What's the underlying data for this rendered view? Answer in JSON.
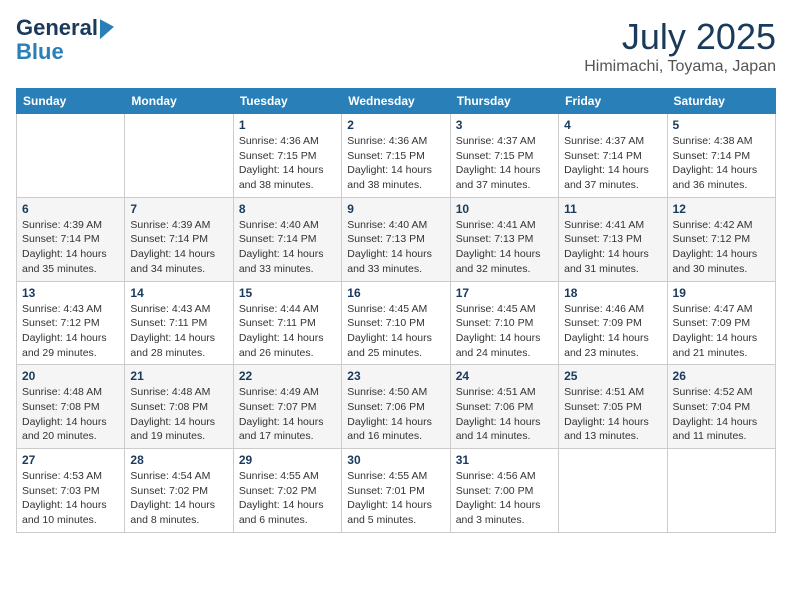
{
  "header": {
    "logo_line1": "General",
    "logo_line2": "Blue",
    "month": "July 2025",
    "location": "Himimachi, Toyama, Japan"
  },
  "days_of_week": [
    "Sunday",
    "Monday",
    "Tuesday",
    "Wednesday",
    "Thursday",
    "Friday",
    "Saturday"
  ],
  "weeks": [
    [
      {
        "day": "",
        "info": ""
      },
      {
        "day": "",
        "info": ""
      },
      {
        "day": "1",
        "info": "Sunrise: 4:36 AM\nSunset: 7:15 PM\nDaylight: 14 hours\nand 38 minutes."
      },
      {
        "day": "2",
        "info": "Sunrise: 4:36 AM\nSunset: 7:15 PM\nDaylight: 14 hours\nand 38 minutes."
      },
      {
        "day": "3",
        "info": "Sunrise: 4:37 AM\nSunset: 7:15 PM\nDaylight: 14 hours\nand 37 minutes."
      },
      {
        "day": "4",
        "info": "Sunrise: 4:37 AM\nSunset: 7:14 PM\nDaylight: 14 hours\nand 37 minutes."
      },
      {
        "day": "5",
        "info": "Sunrise: 4:38 AM\nSunset: 7:14 PM\nDaylight: 14 hours\nand 36 minutes."
      }
    ],
    [
      {
        "day": "6",
        "info": "Sunrise: 4:39 AM\nSunset: 7:14 PM\nDaylight: 14 hours\nand 35 minutes."
      },
      {
        "day": "7",
        "info": "Sunrise: 4:39 AM\nSunset: 7:14 PM\nDaylight: 14 hours\nand 34 minutes."
      },
      {
        "day": "8",
        "info": "Sunrise: 4:40 AM\nSunset: 7:14 PM\nDaylight: 14 hours\nand 33 minutes."
      },
      {
        "day": "9",
        "info": "Sunrise: 4:40 AM\nSunset: 7:13 PM\nDaylight: 14 hours\nand 33 minutes."
      },
      {
        "day": "10",
        "info": "Sunrise: 4:41 AM\nSunset: 7:13 PM\nDaylight: 14 hours\nand 32 minutes."
      },
      {
        "day": "11",
        "info": "Sunrise: 4:41 AM\nSunset: 7:13 PM\nDaylight: 14 hours\nand 31 minutes."
      },
      {
        "day": "12",
        "info": "Sunrise: 4:42 AM\nSunset: 7:12 PM\nDaylight: 14 hours\nand 30 minutes."
      }
    ],
    [
      {
        "day": "13",
        "info": "Sunrise: 4:43 AM\nSunset: 7:12 PM\nDaylight: 14 hours\nand 29 minutes."
      },
      {
        "day": "14",
        "info": "Sunrise: 4:43 AM\nSunset: 7:11 PM\nDaylight: 14 hours\nand 28 minutes."
      },
      {
        "day": "15",
        "info": "Sunrise: 4:44 AM\nSunset: 7:11 PM\nDaylight: 14 hours\nand 26 minutes."
      },
      {
        "day": "16",
        "info": "Sunrise: 4:45 AM\nSunset: 7:10 PM\nDaylight: 14 hours\nand 25 minutes."
      },
      {
        "day": "17",
        "info": "Sunrise: 4:45 AM\nSunset: 7:10 PM\nDaylight: 14 hours\nand 24 minutes."
      },
      {
        "day": "18",
        "info": "Sunrise: 4:46 AM\nSunset: 7:09 PM\nDaylight: 14 hours\nand 23 minutes."
      },
      {
        "day": "19",
        "info": "Sunrise: 4:47 AM\nSunset: 7:09 PM\nDaylight: 14 hours\nand 21 minutes."
      }
    ],
    [
      {
        "day": "20",
        "info": "Sunrise: 4:48 AM\nSunset: 7:08 PM\nDaylight: 14 hours\nand 20 minutes."
      },
      {
        "day": "21",
        "info": "Sunrise: 4:48 AM\nSunset: 7:08 PM\nDaylight: 14 hours\nand 19 minutes."
      },
      {
        "day": "22",
        "info": "Sunrise: 4:49 AM\nSunset: 7:07 PM\nDaylight: 14 hours\nand 17 minutes."
      },
      {
        "day": "23",
        "info": "Sunrise: 4:50 AM\nSunset: 7:06 PM\nDaylight: 14 hours\nand 16 minutes."
      },
      {
        "day": "24",
        "info": "Sunrise: 4:51 AM\nSunset: 7:06 PM\nDaylight: 14 hours\nand 14 minutes."
      },
      {
        "day": "25",
        "info": "Sunrise: 4:51 AM\nSunset: 7:05 PM\nDaylight: 14 hours\nand 13 minutes."
      },
      {
        "day": "26",
        "info": "Sunrise: 4:52 AM\nSunset: 7:04 PM\nDaylight: 14 hours\nand 11 minutes."
      }
    ],
    [
      {
        "day": "27",
        "info": "Sunrise: 4:53 AM\nSunset: 7:03 PM\nDaylight: 14 hours\nand 10 minutes."
      },
      {
        "day": "28",
        "info": "Sunrise: 4:54 AM\nSunset: 7:02 PM\nDaylight: 14 hours\nand 8 minutes."
      },
      {
        "day": "29",
        "info": "Sunrise: 4:55 AM\nSunset: 7:02 PM\nDaylight: 14 hours\nand 6 minutes."
      },
      {
        "day": "30",
        "info": "Sunrise: 4:55 AM\nSunset: 7:01 PM\nDaylight: 14 hours\nand 5 minutes."
      },
      {
        "day": "31",
        "info": "Sunrise: 4:56 AM\nSunset: 7:00 PM\nDaylight: 14 hours\nand 3 minutes."
      },
      {
        "day": "",
        "info": ""
      },
      {
        "day": "",
        "info": ""
      }
    ]
  ]
}
